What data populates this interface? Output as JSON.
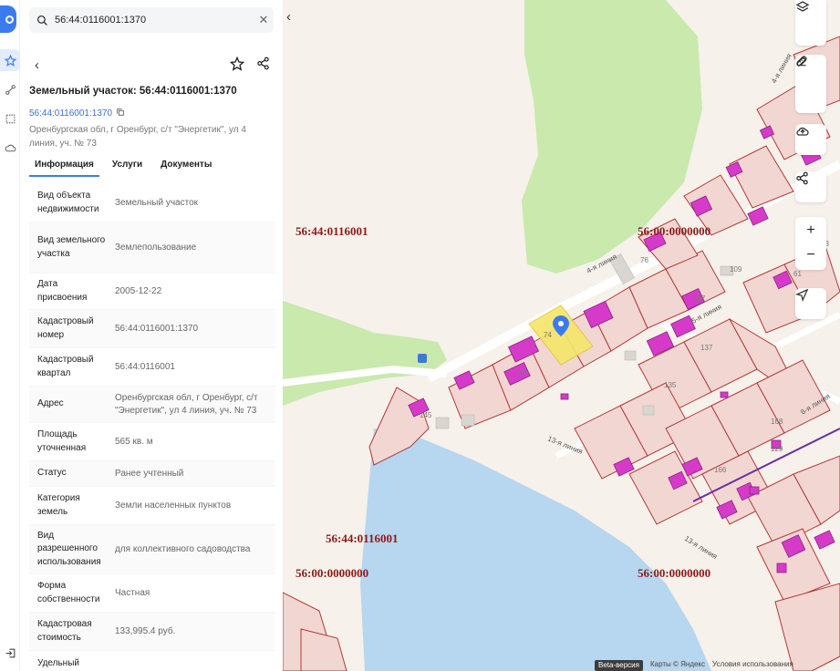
{
  "search": {
    "value": "56:44:0116001:1370"
  },
  "card": {
    "title": "Земельный участок: 56:44:0116001:1370",
    "number_link": "56:44:0116001:1370",
    "address": "Оренбургская обл, г Оренбург, с/т \"Энергетик\", ул 4 линия, уч. № 73"
  },
  "tabs": [
    {
      "label": "Информация",
      "active": true
    },
    {
      "label": "Услуги",
      "active": false
    },
    {
      "label": "Документы",
      "active": false
    }
  ],
  "properties": [
    {
      "key": "Вид объекта недвижимости",
      "value": "Земельный участок"
    },
    {
      "key": "Вид земельного участка",
      "value": "Землепользование"
    },
    {
      "key": "Дата присвоения",
      "value": "2005-12-22"
    },
    {
      "key": "Кадастровый номер",
      "value": "56:44:0116001:1370"
    },
    {
      "key": "Кадастровый квартал",
      "value": "56:44:0116001"
    },
    {
      "key": "Адрес",
      "value": "Оренбургская обл, г Оренбург, с/т \"Энергетик\", ул 4 линия, уч. № 73"
    },
    {
      "key": "Площадь уточненная",
      "value": "565 кв. м"
    },
    {
      "key": "Статус",
      "value": "Ранее учтенный"
    },
    {
      "key": "Категория земель",
      "value": "Земли населенных пунктов"
    },
    {
      "key": "Вид разрешенного использования",
      "value": "для коллективного садоводства"
    },
    {
      "key": "Форма собственности",
      "value": "Частная"
    },
    {
      "key": "Кадастровая стоимость",
      "value": "133,995.4 руб."
    },
    {
      "key": "Удельный",
      "value": ""
    }
  ],
  "map": {
    "labels": {
      "q1": "56:44:0116001",
      "q2": "56:00:0000000",
      "q3": "56:44:0116001",
      "q4": "56:00:0000000",
      "q5": "56:00:0000000"
    },
    "streets": {
      "s1": "4-я линия",
      "s2": "5-я линия",
      "s3": "13-я линия",
      "s4": "13-я линия",
      "s5": "4-я линия",
      "s6": "6-я линия"
    },
    "house_numbers": [
      "109",
      "76",
      "107",
      "137",
      "135",
      "168",
      "166",
      "129",
      "43",
      "61",
      "74",
      "72",
      "145"
    ],
    "zoom_in": "+",
    "zoom_out": "−"
  },
  "footer": {
    "beta": "Beta-версия",
    "copyright": "Карты © Яндекс",
    "terms": "Условия использования"
  },
  "colors": {
    "accent": "#3b7bf0",
    "parcel_outline": "#b03a3a",
    "building": "#d63ac8",
    "selected_parcel": "#f5e66a",
    "water": "#b7d6ef",
    "forest": "#c9e9ad",
    "quarter_label": "#8b1a1a"
  }
}
